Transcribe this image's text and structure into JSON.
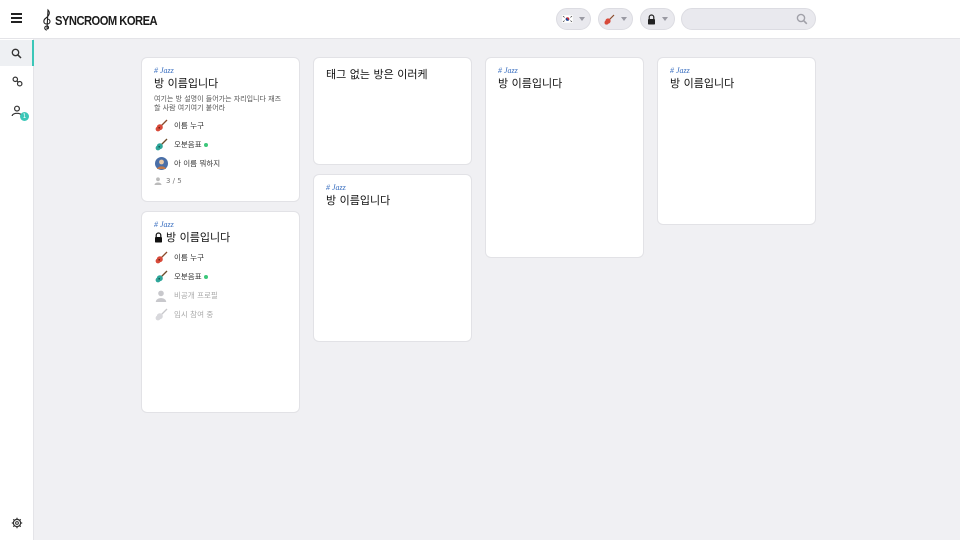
{
  "app": {
    "logo_text": "SYNCROOM KOREA"
  },
  "search": {
    "placeholder": "",
    "value": ""
  },
  "filters": [
    {
      "icon": "korea-flag-icon"
    },
    {
      "icon": "guitar-icon"
    },
    {
      "icon": "lock-icon"
    }
  ],
  "sidebar": {
    "items": [
      {
        "icon": "search-icon",
        "active": true
      },
      {
        "icon": "link-icon",
        "active": false
      },
      {
        "icon": "user-icon",
        "active": false,
        "badge": "1"
      },
      {
        "icon": "gear-icon",
        "active": false
      }
    ]
  },
  "rooms": [
    {
      "tag": "# Jazz",
      "title": "방 이름입니다",
      "locked": false,
      "description": "여기는 방 설명이 들어가는 자리입니다 재즈 할 사람 여기여기 붙어라",
      "members": [
        {
          "icon": "guitar-icon",
          "name": "이름 누구",
          "online": false,
          "muted": false
        },
        {
          "icon": "bass-icon",
          "name": "오분음표",
          "online": true,
          "muted": false
        },
        {
          "icon": "avatar-icon",
          "name": "아 이름 뭐하지",
          "online": false,
          "muted": false
        }
      ],
      "count": "3 / 5"
    },
    {
      "tag": "# Jazz",
      "title": "방 이름입니다",
      "locked": true,
      "members": [
        {
          "icon": "guitar-icon",
          "name": "이름 누구",
          "online": false,
          "muted": false
        },
        {
          "icon": "bass-icon",
          "name": "오분음표",
          "online": true,
          "muted": false
        },
        {
          "icon": "person-icon",
          "name": "비공개 프로필",
          "online": false,
          "muted": true
        },
        {
          "icon": "bass-icon",
          "name": "임시 참여 중",
          "online": false,
          "muted": true
        }
      ]
    },
    {
      "tag": "",
      "title": "태그 없는 방은 이러케"
    },
    {
      "tag": "# Jazz",
      "title": "방 이름입니다"
    },
    {
      "tag": "# Jazz",
      "title": "방 이름입니다"
    },
    {
      "tag": "# Jazz",
      "title": "방 이름입니다"
    }
  ],
  "colors": {
    "accent": "#3cc7b8",
    "tag": "#3a6fc0",
    "online": "#3cc77a",
    "background": "#f0f0f3"
  }
}
